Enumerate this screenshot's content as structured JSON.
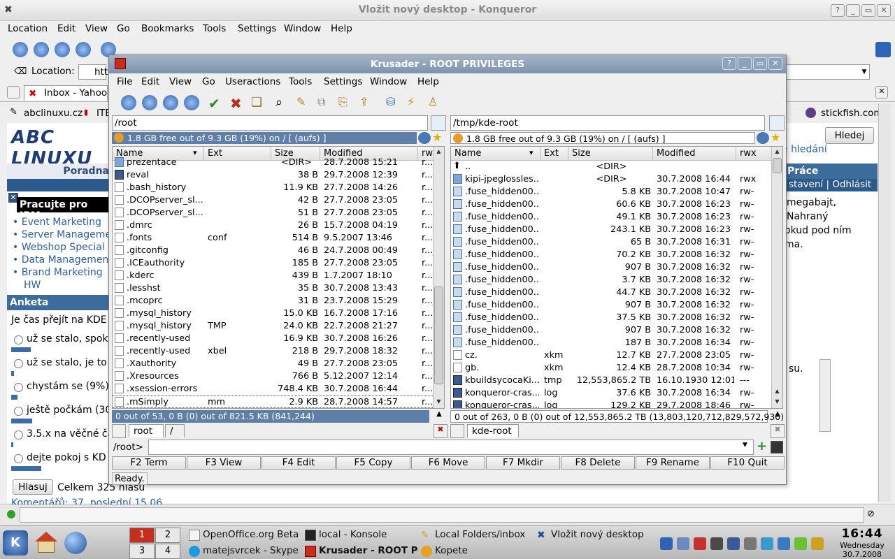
{
  "konqueror": {
    "title": "Vložit nový desktop - Konqueror",
    "menu": [
      "Location",
      "Edit",
      "View",
      "Go",
      "Bookmarks",
      "Tools",
      "Settings",
      "Window",
      "Help"
    ],
    "location_label": "Location:",
    "location_value": "htt",
    "tab_label": "Inbox - Yahoo",
    "bookmarks": [
      "abclinuxu.cz",
      "ITE"
    ],
    "bookmark_right": "stickfish.com",
    "page": {
      "logo_text": "ABC LINUXU",
      "poradna": "Poradna",
      "prace": "Práce",
      "search_link": "e hledání",
      "search_button": "Hledej",
      "nav_links": "stavení | Odhlásit",
      "right_text": [
        "megabajt,",
        "Nahraný",
        "okud pod ním",
        "ma."
      ],
      "small_text": "su.",
      "ibm_head": "Pracujte pro IBM",
      "ibm_links": [
        "Event Marketing",
        "Server Manageme",
        "Webshop Special",
        "Data Managemen",
        "Brand Marketing",
        "HW"
      ],
      "anketa_head": "Anketa",
      "anketa_question": "Je čas přejít na KDE",
      "options": [
        {
          "label": "už se stalo, spok",
          "fraction": 0.28
        },
        {
          "label": "už se stalo, je to",
          "fraction": 0.04
        },
        {
          "label": "chystám se (9%)",
          "fraction": 0.09
        },
        {
          "label": "ještě počkám (30",
          "fraction": 0.3
        },
        {
          "label": "3.5.x na věčné ča",
          "fraction": 0.03
        },
        {
          "label": "dejte pokoj s KD",
          "fraction": 0.43
        }
      ],
      "vote_button": "Hlasuj",
      "total_votes": "Celkem 325 hlasů",
      "bottom_text": "Komentářů: 37, poslední 15.06"
    }
  },
  "krusader": {
    "title": "Krusader - ROOT PRIVILEGES",
    "menu": [
      "File",
      "Edit",
      "View",
      "Go",
      "Useractions",
      "Tools",
      "Settings",
      "Window",
      "Help"
    ],
    "left": {
      "path": "/root",
      "free": "1.8 GB free out of 9.3 GB (19%) on / [ (aufs) ]",
      "columns": [
        "Name",
        "Ext",
        "Size",
        "Modified",
        "rw"
      ],
      "rows": [
        {
          "name": "prezentace",
          "ext": "",
          "size": "<DIR>",
          "mod": "28.7.2008 15:21",
          "rw": "r...",
          "icon": "folder"
        },
        {
          "name": "revaI",
          "ext": "",
          "size": "38 B",
          "mod": "29.7.2008 12:39",
          "rw": "r...",
          "icon": "bin"
        },
        {
          "name": ".bash_history",
          "ext": "",
          "size": "11.9 KB",
          "mod": "27.7.2008 14:26",
          "rw": "r...",
          "icon": "file"
        },
        {
          "name": ".DCOPserver_sl...",
          "ext": "",
          "size": "42 B",
          "mod": "27.7.2008 23:05",
          "rw": "r...",
          "icon": "file"
        },
        {
          "name": ".DCOPserver_sl...",
          "ext": "",
          "size": "51 B",
          "mod": "27.7.2008 23:05",
          "rw": "r...",
          "icon": "file"
        },
        {
          "name": ".dmrc",
          "ext": "",
          "size": "26 B",
          "mod": "15.7.2008 04:19",
          "rw": "r...",
          "icon": "file"
        },
        {
          "name": ".fonts",
          "ext": "conf",
          "size": "514 B",
          "mod": "9.5.2007 13:46",
          "rw": "r...",
          "icon": "file"
        },
        {
          "name": ".gitconfig",
          "ext": "",
          "size": "46 B",
          "mod": "24.7.2008 00:49",
          "rw": "r...",
          "icon": "file"
        },
        {
          "name": ".ICEauthority",
          "ext": "",
          "size": "185 B",
          "mod": "27.7.2008 23:05",
          "rw": "r...",
          "icon": "file"
        },
        {
          "name": ".kderc",
          "ext": "",
          "size": "439 B",
          "mod": "1.7.2007 18:10",
          "rw": "r...",
          "icon": "file"
        },
        {
          "name": ".lesshst",
          "ext": "",
          "size": "35 B",
          "mod": "30.7.2008 13:43",
          "rw": "r...",
          "icon": "file"
        },
        {
          "name": ".mcoprc",
          "ext": "",
          "size": "31 B",
          "mod": "23.7.2008 15:29",
          "rw": "r...",
          "icon": "file"
        },
        {
          "name": ".mysql_history",
          "ext": "",
          "size": "15.0 KB",
          "mod": "16.7.2008 17:16",
          "rw": "r...",
          "icon": "file"
        },
        {
          "name": ".mysql_history",
          "ext": "TMP",
          "size": "24.0 KB",
          "mod": "22.7.2008 21:27",
          "rw": "r...",
          "icon": "file"
        },
        {
          "name": ".recently-used",
          "ext": "",
          "size": "16.9 KB",
          "mod": "30.7.2008 16:26",
          "rw": "r...",
          "icon": "file"
        },
        {
          "name": ".recently-used",
          "ext": "xbel",
          "size": "218 B",
          "mod": "29.7.2008 18:32",
          "rw": "r...",
          "icon": "file"
        },
        {
          "name": ".Xauthority",
          "ext": "",
          "size": "49 B",
          "mod": "27.7.2008 23:05",
          "rw": "r...",
          "icon": "file"
        },
        {
          "name": ".Xresources",
          "ext": "",
          "size": "766 B",
          "mod": "5.12.2007 12:14",
          "rw": "r...",
          "icon": "file"
        },
        {
          "name": ".xsession-errors",
          "ext": "",
          "size": "748.4 KB",
          "mod": "30.7.2008 16:44",
          "rw": "r...",
          "icon": "file"
        },
        {
          "name": ".mSimply",
          "ext": "mm",
          "size": "2.9 KB",
          "mod": "28.7.2008 14:57",
          "rw": "r...",
          "icon": "file"
        }
      ],
      "status": "0 out of 53, 0 B (0) out of 821.5 KB (841,244)",
      "tabs": [
        "root",
        "/"
      ]
    },
    "right": {
      "path": "/tmp/kde-root",
      "free": "1.8 GB free out of 9.3 GB (19%) on / [ (aufs) ]",
      "columns": [
        "Name",
        "Ext",
        "Size",
        "Modified",
        "rwx"
      ],
      "rows": [
        {
          "name": "..",
          "ext": "",
          "size": "<DIR>",
          "mod": "",
          "rw": "",
          "icon": "up"
        },
        {
          "name": "kipi-jpeglossles...",
          "ext": "",
          "size": "<DIR>",
          "mod": "30.7.2008 16:44",
          "rw": "rwx",
          "icon": "folder"
        },
        {
          "name": ".fuse_hidden00...",
          "ext": "",
          "size": "5.8 KB",
          "mod": "30.7.2008 10:47",
          "rw": "rw-",
          "icon": "blue"
        },
        {
          "name": ".fuse_hidden00...",
          "ext": "",
          "size": "60.6 KB",
          "mod": "30.7.2008 16:23",
          "rw": "rw-",
          "icon": "blue"
        },
        {
          "name": ".fuse_hidden00...",
          "ext": "",
          "size": "49.1 KB",
          "mod": "30.7.2008 16:23",
          "rw": "rw-",
          "icon": "blue"
        },
        {
          "name": ".fuse_hidden00...",
          "ext": "",
          "size": "243.1 KB",
          "mod": "30.7.2008 16:23",
          "rw": "rw-",
          "icon": "blue"
        },
        {
          "name": ".fuse_hidden00...",
          "ext": "",
          "size": "65 B",
          "mod": "30.7.2008 16:31",
          "rw": "rw-",
          "icon": "blue"
        },
        {
          "name": ".fuse_hidden00...",
          "ext": "",
          "size": "70.2 KB",
          "mod": "30.7.2008 16:32",
          "rw": "rw-",
          "icon": "blue"
        },
        {
          "name": ".fuse_hidden00...",
          "ext": "",
          "size": "907 B",
          "mod": "30.7.2008 16:32",
          "rw": "rw-",
          "icon": "blue"
        },
        {
          "name": ".fuse_hidden00...",
          "ext": "",
          "size": "3.7 KB",
          "mod": "30.7.2008 16:32",
          "rw": "rw-",
          "icon": "blue"
        },
        {
          "name": ".fuse_hidden00...",
          "ext": "",
          "size": "44.7 KB",
          "mod": "30.7.2008 16:32",
          "rw": "rw-",
          "icon": "blue"
        },
        {
          "name": ".fuse_hidden00...",
          "ext": "",
          "size": "907 B",
          "mod": "30.7.2008 16:32",
          "rw": "rw-",
          "icon": "blue"
        },
        {
          "name": ".fuse_hidden00...",
          "ext": "",
          "size": "37.5 KB",
          "mod": "30.7.2008 16:32",
          "rw": "rw-",
          "icon": "blue"
        },
        {
          "name": ".fuse_hidden00...",
          "ext": "",
          "size": "907 B",
          "mod": "30.7.2008 16:32",
          "rw": "rw-",
          "icon": "blue"
        },
        {
          "name": ".fuse_hidden00...",
          "ext": "",
          "size": "187 B",
          "mod": "30.7.2008 16:34",
          "rw": "rw-",
          "icon": "blue"
        },
        {
          "name": "cz.",
          "ext": "xkm",
          "size": "12.7 KB",
          "mod": "27.7.2008 23:05",
          "rw": "rw-",
          "icon": "file"
        },
        {
          "name": "gb.",
          "ext": "xkm",
          "size": "12.4 KB",
          "mod": "28.7.2008 10:34",
          "rw": "rw-",
          "icon": "file"
        },
        {
          "name": "kbuildsycocaKi...",
          "ext": "tmp",
          "size": "12,553,865.2 TB",
          "mod": "16.10.1930 12:01",
          "rw": "---",
          "icon": "bin"
        },
        {
          "name": "konqueror-cras...",
          "ext": "log",
          "size": "37.6 KB",
          "mod": "30.7.2008 16:34",
          "rw": "rw-",
          "icon": "bin"
        },
        {
          "name": "konqueror-cras...",
          "ext": "log",
          "size": "129.2 KB",
          "mod": "29.7.2008 18:46",
          "rw": "rw-",
          "icon": "bin"
        }
      ],
      "status": "0 out of 263, 0 B (0) out of 12,553,865.2 TB (13,803,120,712,829,572,930)",
      "tabs": [
        "kde-root"
      ]
    },
    "cmd_prompt": "/root>",
    "fkeys": [
      "F2 Term",
      "F3 View",
      "F4 Edit",
      "F5 Copy",
      "F6 Move",
      "F7 Mkdir",
      "F8 Delete",
      "F9 Rename",
      "F10 Quit"
    ],
    "status": "Ready."
  },
  "taskbar": {
    "pager": [
      "1",
      "2",
      "3",
      "4"
    ],
    "tasks_top": [
      "OpenOffice.org Beta",
      "local - Konsole",
      "Local Folders/inbox",
      "Vložit nový desktop"
    ],
    "tasks_bottom": [
      "matejsvrcek - Skype",
      "Krusader - ROOT P",
      "Kopete"
    ],
    "clock_time": "16:44",
    "clock_day": "Wednesday",
    "clock_date": "30.7.2008"
  }
}
